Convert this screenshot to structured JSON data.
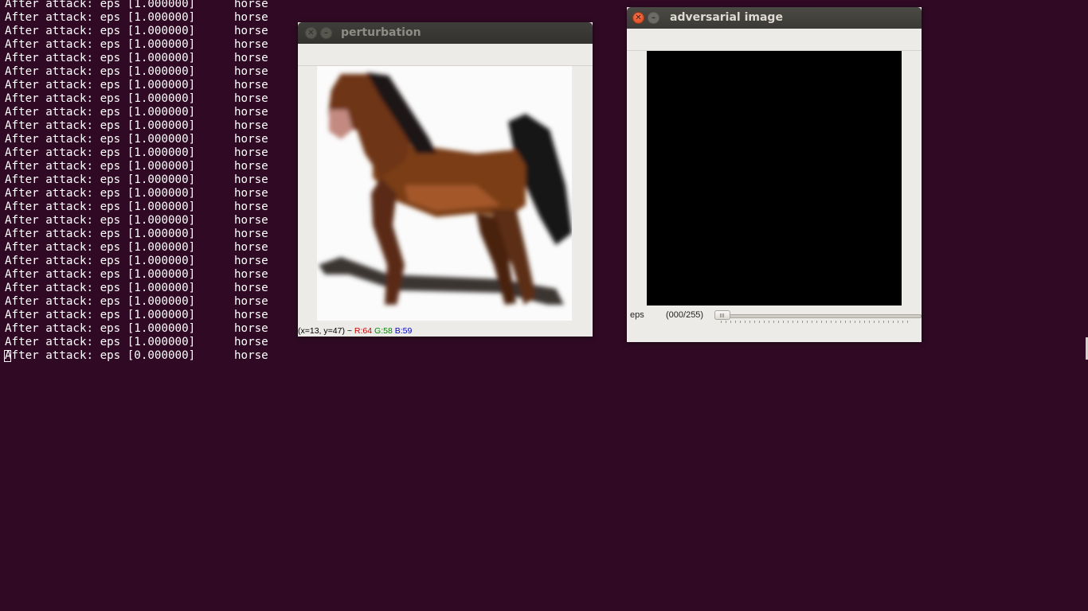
{
  "terminal": {
    "message": "After attack: eps [1.000000]",
    "label": "horse",
    "repeat_count": 26,
    "last_line": {
      "message_first_char": "A",
      "message_rest": "fter attack: eps [0.000000]",
      "label": "horse"
    }
  },
  "perturbation_window": {
    "title": "perturbation",
    "status": {
      "coords": "(x=13, y=47) ~",
      "r": "R:64",
      "g": "G:58",
      "b": "B:59"
    },
    "image_subject": "pixelated brown horse with black mane and tail on white background"
  },
  "adversarial_window": {
    "title": "adversarial image",
    "image_fill": "#000000",
    "trackbar": {
      "name": "eps",
      "value_text": "(000/255)",
      "value": 0,
      "max": 255
    }
  },
  "colors": {
    "desktop_bg": "#300a24",
    "terminal_text": "#ffffff",
    "status_r": "#d00000",
    "status_g": "#008800",
    "status_b": "#0000cc"
  }
}
